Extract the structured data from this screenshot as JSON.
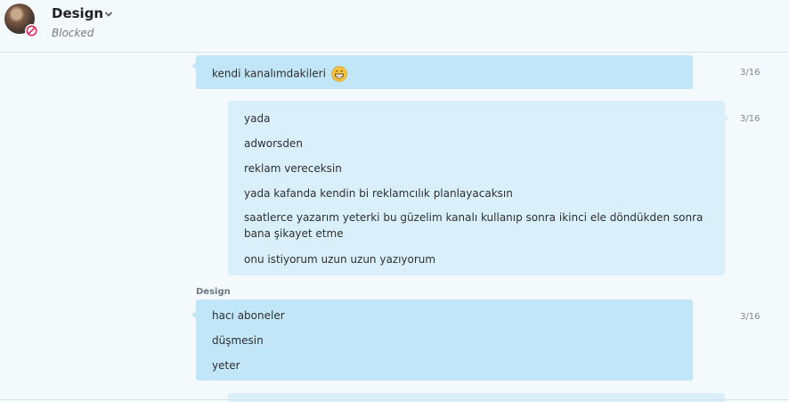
{
  "header": {
    "contact_name": "Design",
    "contact_status": "Blocked"
  },
  "messages": {
    "m1": {
      "text": "kendi kanalımdakileri",
      "time": "3/16",
      "emoji": "grinning-face-icon"
    },
    "m2": {
      "lines": [
        "yada",
        "adworsden",
        "reklam vereceksin",
        "yada kafanda kendin bi reklamcılık planlayacaksın",
        "saatlerce yazarım yeterki bu güzelim kanalı kullanıp sonra ikinci ele döndükden sonra bana şikayet etme",
        "onu istiyorum uzun uzun yazıyorum"
      ],
      "time": "3/16"
    },
    "m3": {
      "sender": "Design",
      "lines": [
        "hacı aboneler",
        "düşmesin",
        "yeter"
      ],
      "time": "3/16"
    }
  },
  "colors": {
    "incoming_bubble": "#c1e6f7",
    "outgoing_bubble": "#d9f0fa",
    "background": "#f4f9fc",
    "blocked_red": "#e0245e"
  }
}
